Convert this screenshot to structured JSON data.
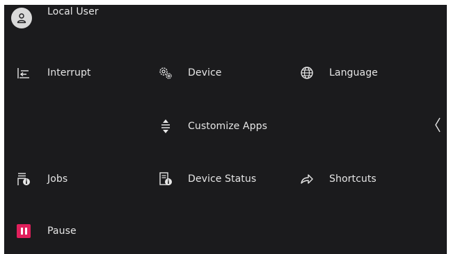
{
  "user": {
    "label": "Local User"
  },
  "menu": {
    "interrupt": "Interrupt",
    "device": "Device",
    "language": "Language",
    "customize_apps": "Customize Apps",
    "jobs": "Jobs",
    "device_status": "Device Status",
    "shortcuts": "Shortcuts",
    "pause": "Pause"
  },
  "icons": {
    "user": "person-icon",
    "interrupt": "interrupt-icon",
    "device": "gears-icon",
    "language": "globe-icon",
    "customize_apps": "sort-arrows-icon",
    "jobs": "jobs-icon",
    "device_status": "device-status-icon",
    "shortcuts": "share-arrow-icon",
    "pause": "pause-icon",
    "collapse": "chevron-left-icon"
  },
  "colors": {
    "background": "#1b1b1d",
    "text": "#e6e6e6",
    "pause_accent": "#e0205c"
  }
}
